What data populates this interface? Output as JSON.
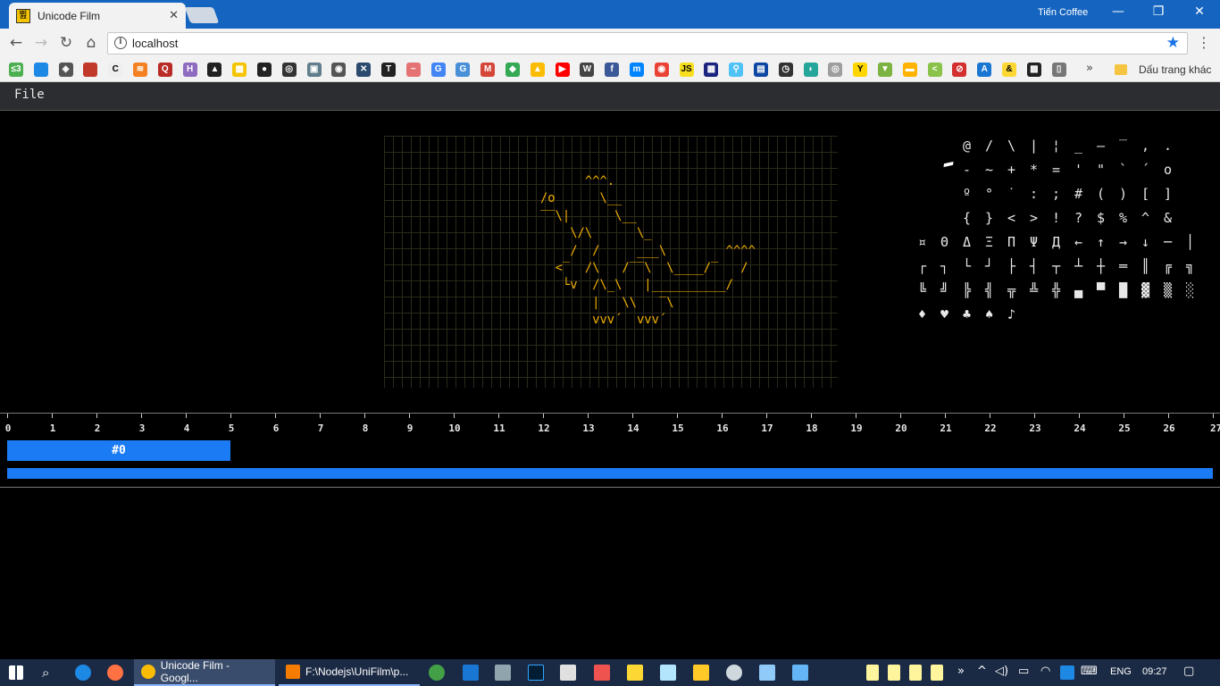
{
  "browser": {
    "tab_title": "Unicode Film",
    "tab_favicon": "쀮",
    "tab_close": "✕",
    "profile_name": "Tiến Coffee",
    "window_controls": [
      "—",
      "❐",
      "✕"
    ],
    "url": "localhost",
    "info_glyph": "i",
    "nav": {
      "back": "←",
      "forward": "→",
      "reload": "↻",
      "home": "⌂"
    },
    "star_glyph": "★",
    "menu_glyph": "⋮",
    "bookmarks_more": "»",
    "other_bookmarks": "Dấu trang khác",
    "bookmarks": [
      {
        "label": "≤3",
        "color": "#4caf50"
      },
      {
        "label": "",
        "color": "#1e88e5"
      },
      {
        "label": "◈",
        "color": "#555"
      },
      {
        "label": "",
        "color": "#c0392b"
      },
      {
        "label": "C",
        "color": "#eee"
      },
      {
        "label": "≋",
        "color": "#f48024"
      },
      {
        "label": "Q",
        "color": "#b92b27"
      },
      {
        "label": "H",
        "color": "#8e6cbf"
      },
      {
        "label": "▲",
        "color": "#222"
      },
      {
        "label": "▦",
        "color": "#f5c400"
      },
      {
        "label": "●",
        "color": "#222"
      },
      {
        "label": "◎",
        "color": "#333"
      },
      {
        "label": "▣",
        "color": "#607d8b"
      },
      {
        "label": "◉",
        "color": "#555"
      },
      {
        "label": "✕",
        "color": "#2b4a6e"
      },
      {
        "label": "T",
        "color": "#222"
      },
      {
        "label": "~",
        "color": "#e57373"
      },
      {
        "label": "G",
        "color": "#4285f4"
      },
      {
        "label": "G",
        "color": "#4a90d9"
      },
      {
        "label": "M",
        "color": "#d44638"
      },
      {
        "label": "◆",
        "color": "#34a853"
      },
      {
        "label": "▲",
        "color": "#fbbc05"
      },
      {
        "label": "▶",
        "color": "#ff0000"
      },
      {
        "label": "W",
        "color": "#444"
      },
      {
        "label": "f",
        "color": "#3b5998"
      },
      {
        "label": "m",
        "color": "#0084ff"
      },
      {
        "label": "◉",
        "color": "#ea4335"
      },
      {
        "label": "JS",
        "color": "#f7df1e"
      },
      {
        "label": "▦",
        "color": "#1a237e"
      },
      {
        "label": "⚲",
        "color": "#4fc3f7"
      },
      {
        "label": "▤",
        "color": "#0d47a1"
      },
      {
        "label": "◷",
        "color": "#333"
      },
      {
        "label": "◗",
        "color": "#26a69a"
      },
      {
        "label": "◎",
        "color": "#9e9e9e"
      },
      {
        "label": "Y",
        "color": "#ffd600"
      },
      {
        "label": "▼",
        "color": "#7cb342"
      },
      {
        "label": "▬",
        "color": "#ffb300"
      },
      {
        "label": "<",
        "color": "#8bc34a"
      },
      {
        "label": "⊘",
        "color": "#d32f2f"
      },
      {
        "label": "A",
        "color": "#1976d2"
      },
      {
        "label": "&",
        "color": "#fdd835"
      },
      {
        "label": "▩",
        "color": "#222"
      },
      {
        "label": "▯",
        "color": "#777"
      }
    ]
  },
  "app": {
    "menu_file": "File",
    "art_text": "      ^^^.\n/o      \\__\n‾‾\\|      \\__\n    \\/\\      \\_\n    /  /     ___\\        ^^^^\n  <‾  /\\   /‾‾\\  \\____/‾   /\n   └v  /\\_\\   |__________/\n       |   \\\\   ‾\\\n       vvv´  vvv´",
    "palette": [
      [
        "",
        "",
        "@",
        "/",
        "\\",
        "|",
        "¦",
        "_",
        "–",
        "‾",
        ",",
        "."
      ],
      [
        "",
        "",
        "-",
        "~",
        "+",
        "*",
        "=",
        "'",
        "\"",
        "`",
        "´",
        "o"
      ],
      [
        "",
        "",
        "º",
        "°",
        "˙",
        ":",
        ";",
        "#",
        "(",
        ")",
        "[",
        "]"
      ],
      [
        "",
        "",
        "{",
        "}",
        "<",
        ">",
        "!",
        "?",
        "$",
        "%",
        "^",
        "&"
      ],
      [
        "¤",
        "Θ",
        "Δ",
        "Ξ",
        "Π",
        "Ψ",
        "Д",
        "←",
        "↑",
        "→",
        "↓",
        "─",
        "│"
      ],
      [
        "┌",
        "┐",
        "└",
        "┘",
        "├",
        "┤",
        "┬",
        "┴",
        "┼",
        "═",
        "║",
        "╔",
        "╗"
      ],
      [
        "╚",
        "╝",
        "╠",
        "╣",
        "╦",
        "╩",
        "╬",
        "▄",
        "▀",
        "█",
        "▓",
        "▒",
        "░"
      ],
      [
        "♦",
        "♥",
        "♣",
        "♠",
        "♪"
      ]
    ],
    "timeline": {
      "ticks": [
        "0",
        "1",
        "2",
        "3",
        "4",
        "5",
        "6",
        "7",
        "8",
        "9",
        "10",
        "11",
        "12",
        "13",
        "14",
        "15",
        "16",
        "17",
        "18",
        "19",
        "20",
        "21",
        "22",
        "23",
        "24",
        "25",
        "26",
        "27"
      ],
      "frame_label": "#0"
    }
  },
  "taskbar": {
    "apps": [
      {
        "label": "Unicode Film - Googl...",
        "color": "#fbbc05",
        "active": true
      },
      {
        "label": "F:\\Nodejs\\UniFilm\\p...",
        "color": "#f57c00",
        "active": false
      }
    ],
    "tray_chevron": "»",
    "tray_up": "^",
    "language": "ENG",
    "time": "09:27"
  }
}
